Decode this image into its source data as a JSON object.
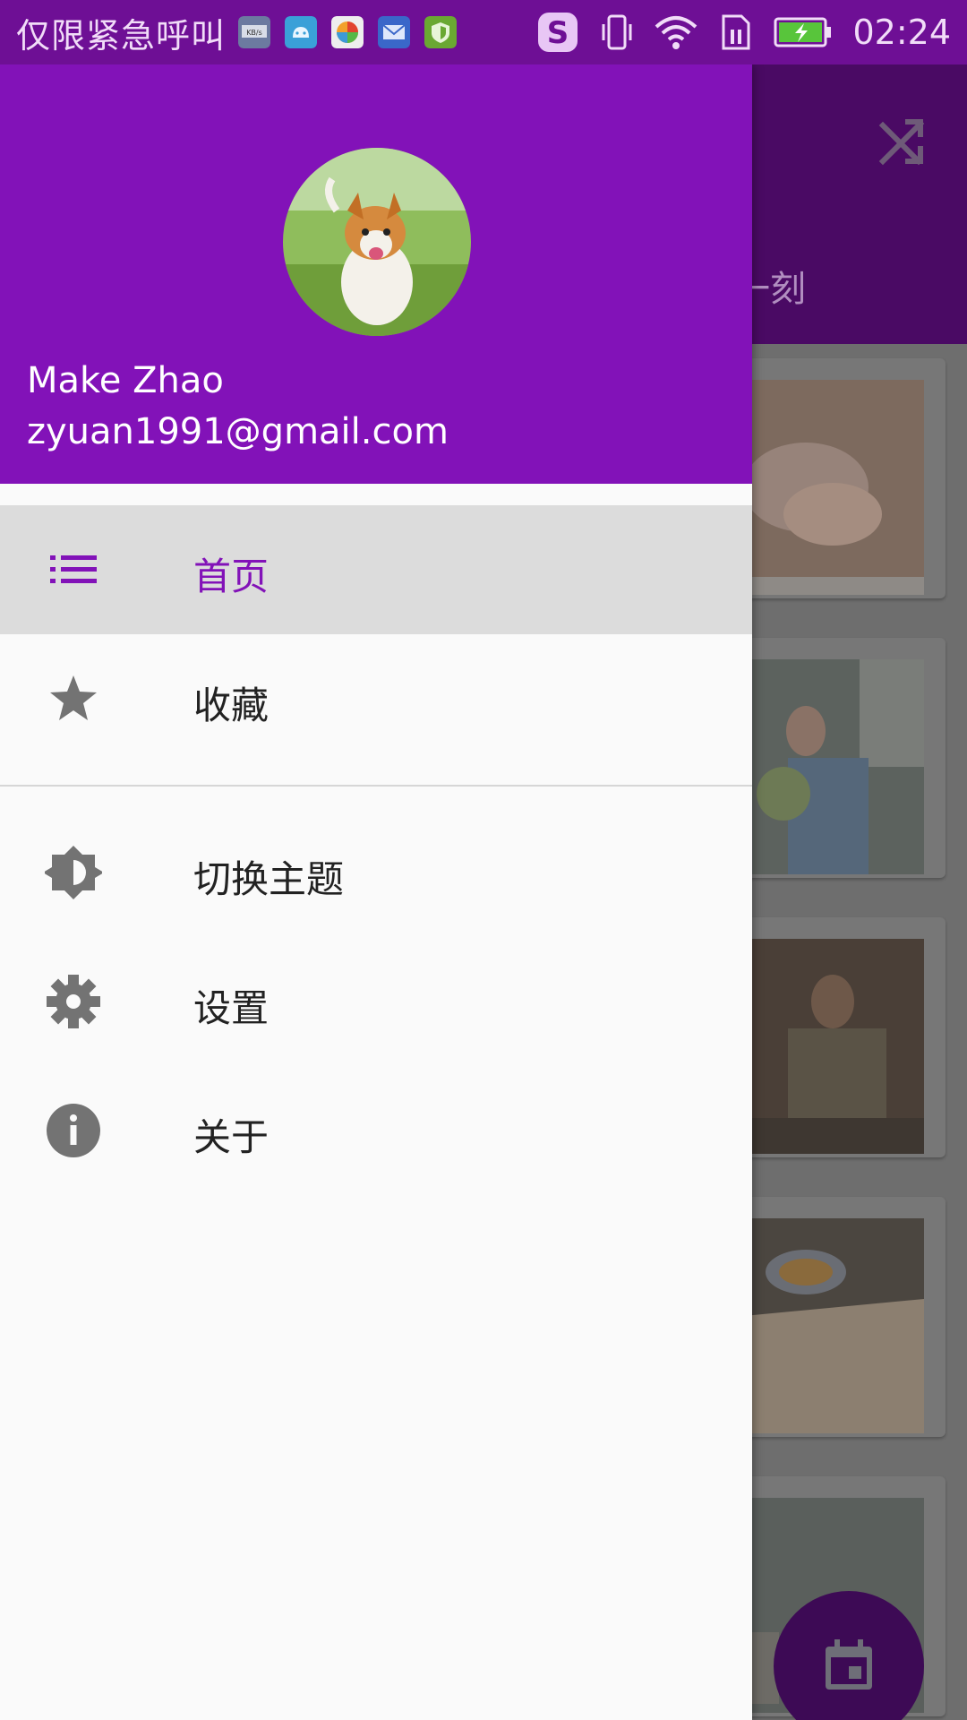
{
  "status_bar": {
    "carrier_text": "仅限紧急呼叫",
    "time": "02:24"
  },
  "main": {
    "subtitle_partial": "一刻"
  },
  "drawer": {
    "user": {
      "name": "Make Zhao",
      "email": "zyuan1991@gmail.com"
    },
    "items": [
      {
        "label": "首页",
        "icon": "list-icon",
        "active": true
      },
      {
        "label": "收藏",
        "icon": "star-icon",
        "active": false
      },
      {
        "label": "切换主题",
        "icon": "brightness-icon",
        "active": false
      },
      {
        "label": "设置",
        "icon": "gear-icon",
        "active": false
      },
      {
        "label": "关于",
        "icon": "info-icon",
        "active": false
      }
    ]
  },
  "colors": {
    "primary": "#8212b8",
    "status_bar": "#6e0f95",
    "drawer_bg": "#fafafa",
    "active_item_bg": "#dcdcdc",
    "icon_gray": "#737373"
  }
}
